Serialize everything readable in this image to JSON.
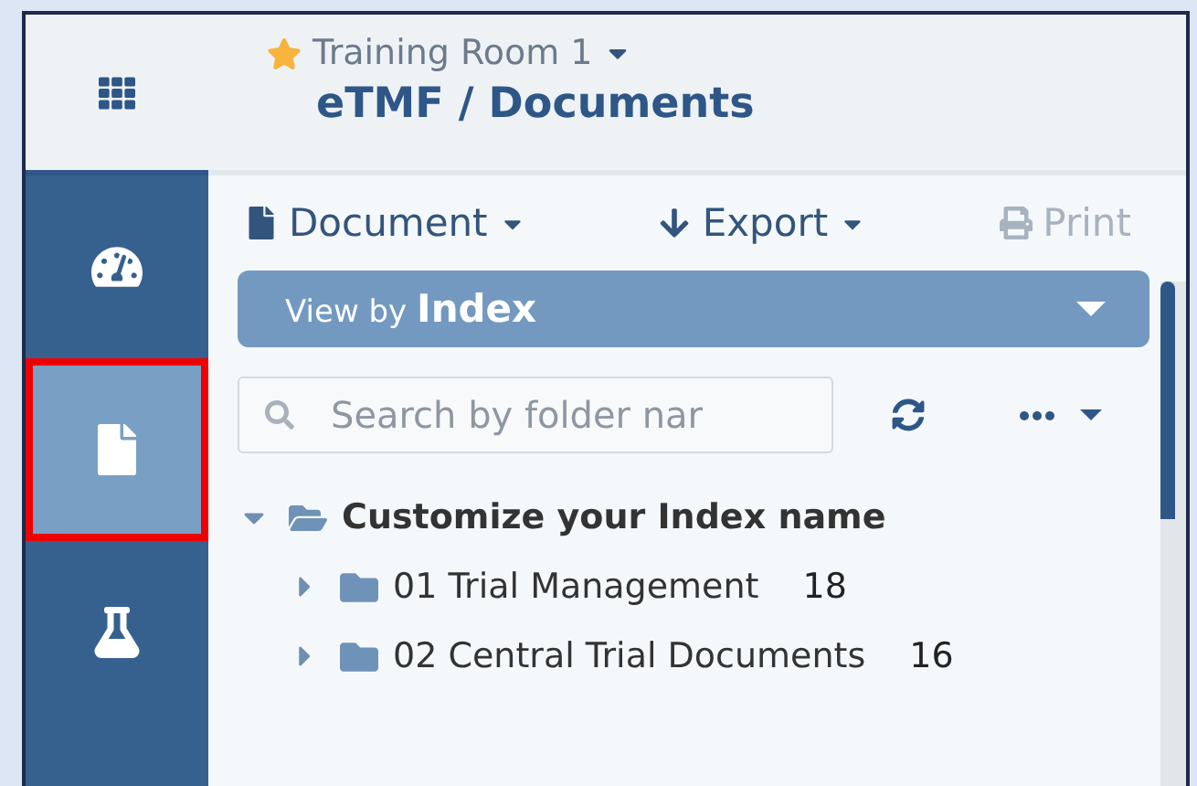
{
  "header": {
    "room": "Training Room 1",
    "favorite": true,
    "title": "eTMF / Documents"
  },
  "sidebar": {
    "items": [
      {
        "kind": "dashboard",
        "selected": false,
        "highlighted": false
      },
      {
        "kind": "document",
        "selected": true,
        "highlighted": true
      },
      {
        "kind": "flask",
        "selected": false,
        "highlighted": false
      }
    ]
  },
  "toolbar": [
    {
      "kind": "document",
      "label": "Document",
      "disabled": false,
      "dropdown": true
    },
    {
      "kind": "export",
      "label": "Export",
      "disabled": false,
      "dropdown": true
    },
    {
      "kind": "print",
      "label": "Print",
      "disabled": true,
      "dropdown": false
    }
  ],
  "view_by": {
    "prefix": "View by",
    "value": "Index"
  },
  "search": {
    "placeholder": "Search by folder nar"
  },
  "tree": [
    {
      "label": "Customize your Index name",
      "expanded": true,
      "children": [
        {
          "label": "01 Trial Management",
          "count": "18",
          "expanded": false
        },
        {
          "label": "02 Central Trial Documents",
          "count": "16",
          "expanded": false
        }
      ]
    }
  ]
}
